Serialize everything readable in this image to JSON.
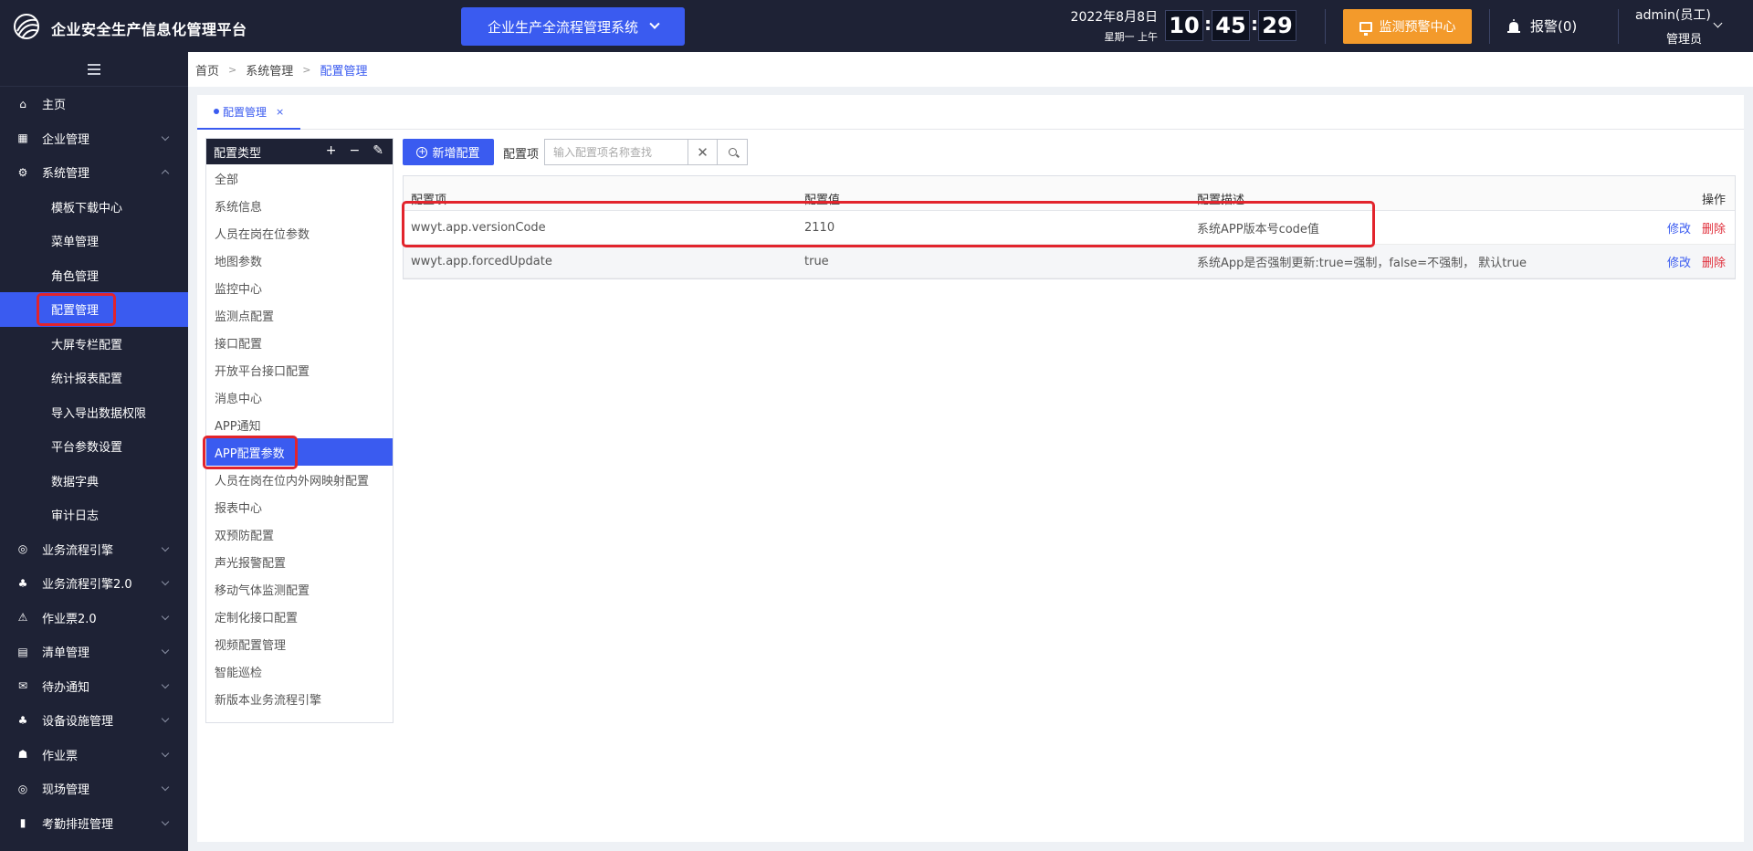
{
  "header": {
    "app_title": "企业安全生产信息化管理平台",
    "system_select": "企业生产全流程管理系统",
    "date": "2022年8月8日",
    "weekday": "星期一 上午",
    "clock": {
      "hh": "10",
      "mm": "45",
      "ss": "29"
    },
    "monitor_button": "监测预警中心",
    "alarm": "报警(0)",
    "user_name": "admin(员工)",
    "user_role": "管理员"
  },
  "sidebar": {
    "items": [
      {
        "label": "主页",
        "icon": "home-icon",
        "glyph": "⌂"
      },
      {
        "label": "企业管理",
        "icon": "building-icon",
        "glyph": "▦"
      },
      {
        "label": "系统管理",
        "icon": "gear-icon",
        "glyph": "⚙"
      }
    ],
    "sub_items": [
      {
        "label": "模板下载中心"
      },
      {
        "label": "菜单管理"
      },
      {
        "label": "角色管理"
      },
      {
        "label": "配置管理"
      },
      {
        "label": "大屏专栏配置"
      },
      {
        "label": "统计报表配置"
      },
      {
        "label": "导入导出数据权限"
      },
      {
        "label": "平台参数设置"
      },
      {
        "label": "数据字典"
      },
      {
        "label": "审计日志"
      }
    ],
    "more_items": [
      {
        "label": "业务流程引擎",
        "icon": "workflow-icon",
        "glyph": "◎"
      },
      {
        "label": "业务流程引擎2.0",
        "icon": "hierarchy-icon",
        "glyph": "♣"
      },
      {
        "label": "作业票2.0",
        "icon": "ticket-icon",
        "glyph": "⚠"
      },
      {
        "label": "清单管理",
        "icon": "list-icon",
        "glyph": "▤"
      },
      {
        "label": "待办通知",
        "icon": "mail-icon",
        "glyph": "✉"
      },
      {
        "label": "设备设施管理",
        "icon": "device-icon",
        "glyph": "♣"
      },
      {
        "label": "作业票",
        "icon": "worker-icon",
        "glyph": "☗"
      },
      {
        "label": "现场管理",
        "icon": "site-icon",
        "glyph": "◎"
      },
      {
        "label": "考勤排班管理",
        "icon": "chart-icon",
        "glyph": "▮"
      }
    ]
  },
  "breadcrumb": {
    "home": "首页",
    "parent": "系统管理",
    "current": "配置管理"
  },
  "tab": {
    "label": "配置管理",
    "close": "×"
  },
  "config_types": {
    "header": "配置类型",
    "tools": [
      "+",
      "−",
      "✎"
    ],
    "items": [
      "全部",
      "系统信息",
      "人员在岗在位参数",
      "地图参数",
      "监控中心",
      "监测点配置",
      "接口配置",
      "开放平台接口配置",
      "消息中心",
      "APP通知",
      "APP配置参数",
      "人员在岗在位内外网映射配置",
      "报表中心",
      "双预防配置",
      "声光报警配置",
      "移动气体监测配置",
      "定制化接口配置",
      "视频配置管理",
      "智能巡检",
      "新版本业务流程引擎"
    ]
  },
  "toolbar": {
    "add_button": "新增配置",
    "field_label": "配置项",
    "search_placeholder": "输入配置项名称查找",
    "clear": "✕"
  },
  "table": {
    "columns": [
      "配置项",
      "配置值",
      "配置描述",
      "操作"
    ],
    "rows": [
      {
        "key": "wwyt.app.versionCode",
        "value": "2110",
        "desc": "系统APP版本号code值",
        "edit": "修改",
        "delete": "删除"
      },
      {
        "key": "wwyt.app.forcedUpdate",
        "value": "true",
        "desc": "系统App是否强制更新:true=强制，false=不强制， 默认true",
        "edit": "修改",
        "delete": "删除"
      }
    ]
  },
  "colors": {
    "topbar": "#1e2235",
    "accent": "#3a5bf0",
    "warning": "#f39a2b",
    "highlight": "#e2242c",
    "danger": "#e0303c"
  }
}
